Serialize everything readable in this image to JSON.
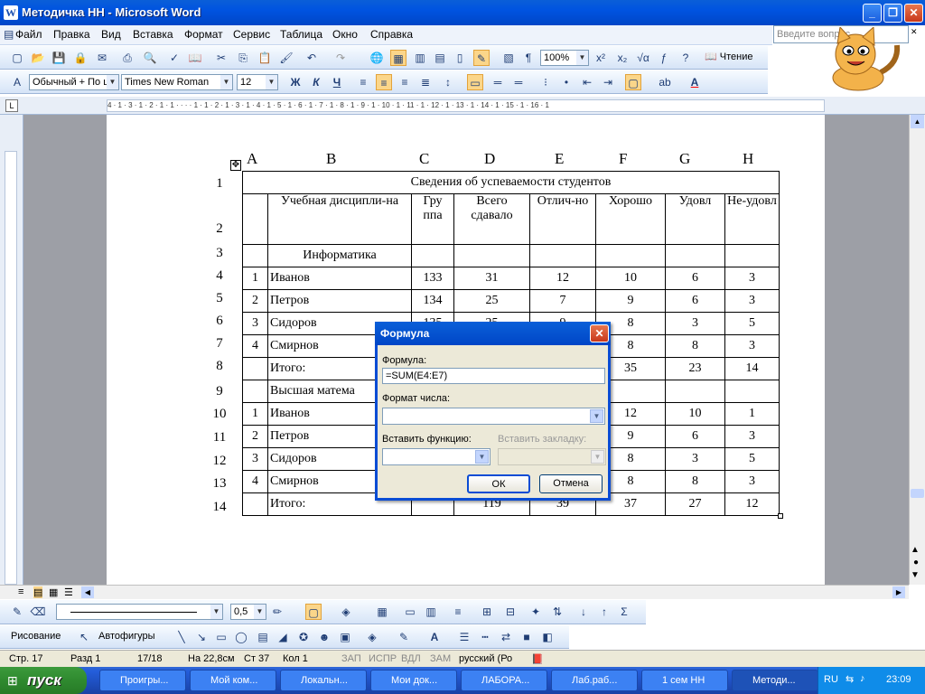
{
  "window": {
    "title": "Методичка НН - Microsoft Word"
  },
  "menu": [
    "Файл",
    "Правка",
    "Вид",
    "Вставка",
    "Формат",
    "Сервис",
    "Таблица",
    "Окно",
    "Справка"
  ],
  "help_placeholder": "Введите вопрос",
  "toolbar": {
    "zoom": "100%",
    "read_label": "Чтение",
    "style": "Обычный + По ц",
    "font": "Times New Roman",
    "size": "12",
    "bold": "Ж",
    "italic": "К",
    "underline": "Ч"
  },
  "ruler": {
    "h": "4 · 1 · 3 · 1 · 2 · 1 · 1 · · · · 1 · 1 · 2 · 1 · 3 · 1 · 4 · 1 · 5 · 1 · 6 · 1 · 7 · 1 · 8 · 1 · 9 · 1 · 10 · 1 · 11 · 1 · 12 · 1 · 13 · 1 · 14 · 1 · 15 · 1 · 16 · 1"
  },
  "table": {
    "col_heads": [
      "A",
      "B",
      "C",
      "D",
      "E",
      "F",
      "G",
      "H"
    ],
    "row_heads": [
      "1",
      "2",
      "3",
      "4",
      "5",
      "6",
      "7",
      "8",
      "9",
      "10",
      "11",
      "12",
      "13",
      "14"
    ],
    "title": "Сведения об успеваемости студентов",
    "header": [
      "",
      "Учебная дисципли-на",
      "Гру ппа",
      "Всего сдавало",
      "Отлич-но",
      "Хорошо",
      "Удовл",
      "Не-удовл"
    ],
    "rows": [
      [
        "",
        "Информатика",
        "",
        "",
        "",
        "",
        "",
        ""
      ],
      [
        "1",
        "Иванов",
        "133",
        "31",
        "12",
        "10",
        "6",
        "3"
      ],
      [
        "2",
        "Петров",
        "134",
        "25",
        "7",
        "9",
        "6",
        "3"
      ],
      [
        "3",
        "Сидоров",
        "135",
        "25",
        "9",
        "8",
        "3",
        "5"
      ],
      [
        "4",
        "Смирнов",
        "",
        "",
        "",
        "8",
        "8",
        "3"
      ],
      [
        "",
        "Итого:",
        "",
        "",
        "",
        "35",
        "23",
        "14"
      ],
      [
        "",
        "Высшая матема",
        "",
        "",
        "",
        "",
        "",
        ""
      ],
      [
        "1",
        "Иванов",
        "",
        "",
        "",
        "12",
        "10",
        "1"
      ],
      [
        "2",
        "Петров",
        "",
        "",
        "",
        "9",
        "6",
        "3"
      ],
      [
        "3",
        "Сидоров",
        "",
        "",
        "",
        "8",
        "3",
        "5"
      ],
      [
        "4",
        "Смирнов",
        "",
        "",
        "",
        "8",
        "8",
        "3"
      ],
      [
        "",
        "Итого:",
        "",
        "119",
        "39",
        "37",
        "27",
        "12"
      ]
    ]
  },
  "dialog": {
    "title": "Формула",
    "formula_label": "Формула:",
    "formula_value": "=SUM(E4:E7)",
    "format_label": "Формат числа:",
    "func_label": "Вставить функцию:",
    "bookmark_label": "Вставить закладку:",
    "ok": "ОК",
    "cancel": "Отмена"
  },
  "drawing": {
    "draw": "Рисование",
    "autoshapes": "Автофигуры",
    "line_width": "0,5"
  },
  "status": [
    "Стр. 17",
    "Разд 1",
    "17/18",
    "На 22,8см",
    "Ст 37",
    "Кол 1",
    "ЗАП",
    "ИСПР",
    "ВДЛ",
    "ЗАМ",
    "русский (Ро"
  ],
  "taskbar": {
    "start": "пуск",
    "tasks": [
      "Проигры...",
      "Мой ком...",
      "Локальн...",
      "Мои док...",
      "ЛАБОРА...",
      "Лаб.раб...",
      "1 сем НН",
      "Методи..."
    ],
    "lang": "RU",
    "time": "23:09"
  }
}
